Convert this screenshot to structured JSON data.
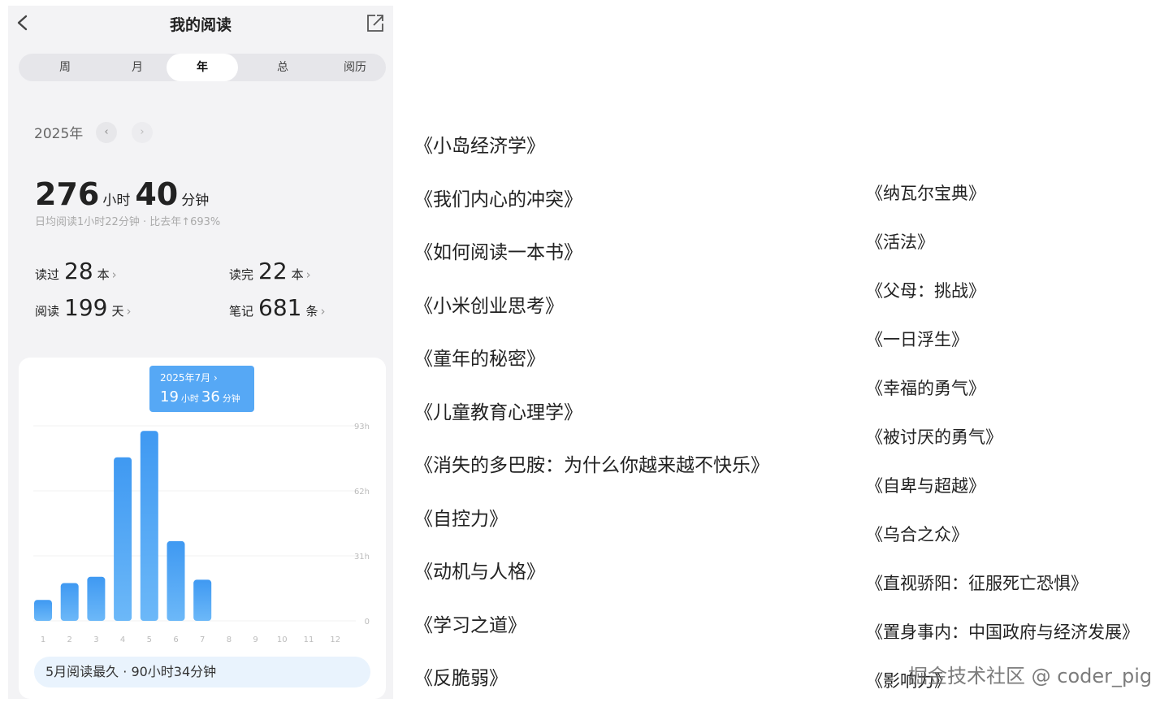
{
  "header": {
    "title": "我的阅读"
  },
  "tabs": [
    {
      "label": "周"
    },
    {
      "label": "月"
    },
    {
      "label": "年",
      "active": true
    },
    {
      "label": "总"
    },
    {
      "label": "阅历"
    }
  ],
  "year": {
    "label": "2025年",
    "prev": "‹",
    "next": "›"
  },
  "total": {
    "hours": "276",
    "hours_unit": "小时",
    "minutes": "40",
    "minutes_unit": "分钟"
  },
  "subline": "日均阅读1小时22分钟 · 比去年↑693%",
  "stats": {
    "read": {
      "label": "读过",
      "value": "28",
      "unit": "本"
    },
    "finished": {
      "label": "读完",
      "value": "22",
      "unit": "本"
    },
    "days": {
      "label": "阅读",
      "value": "199",
      "unit": "天"
    },
    "notes": {
      "label": "笔记",
      "value": "681",
      "unit": "条"
    }
  },
  "tooltip": {
    "date": "2025年7月 ›",
    "hours": "19",
    "hours_unit": "小时",
    "minutes": "36",
    "minutes_unit": "分钟"
  },
  "summary": "5月阅读最久 · 90小时34分钟",
  "chart_data": {
    "type": "bar",
    "categories": [
      "1",
      "2",
      "3",
      "4",
      "5",
      "6",
      "7",
      "8",
      "9",
      "10",
      "11",
      "12"
    ],
    "values": [
      10,
      18,
      21,
      78,
      90.6,
      38,
      19.6,
      0,
      0,
      0,
      0,
      0
    ],
    "y_ticks": [
      "0",
      "31h",
      "62h",
      "93h"
    ],
    "y_tick_values": [
      0,
      31,
      62,
      93
    ],
    "ylim": [
      0,
      93
    ],
    "color": "#4fa5f4",
    "grid": true,
    "highlight_index": 6
  },
  "books_left": [
    "《小岛经济学》",
    "《我们内心的冲突》",
    "《如何阅读一本书》",
    "《小米创业思考》",
    "《童年的秘密》",
    "《儿童教育心理学》",
    "《消失的多巴胺：为什么你越来越不快乐》",
    "《自控力》",
    "《动机与人格》",
    "《学习之道》",
    "《反脆弱》"
  ],
  "books_right": [
    "《纳瓦尔宝典》",
    "《活法》",
    "《父母：挑战》",
    "《一日浮生》",
    "《幸福的勇气》",
    "《被讨厌的勇气》",
    "《自卑与超越》",
    "《乌合之众》",
    "《直视骄阳：征服死亡恐惧》",
    "《置身事内：中国政府与经济发展》",
    "《影响力》"
  ],
  "watermark": "掘金技术社区 @ coder_pig"
}
